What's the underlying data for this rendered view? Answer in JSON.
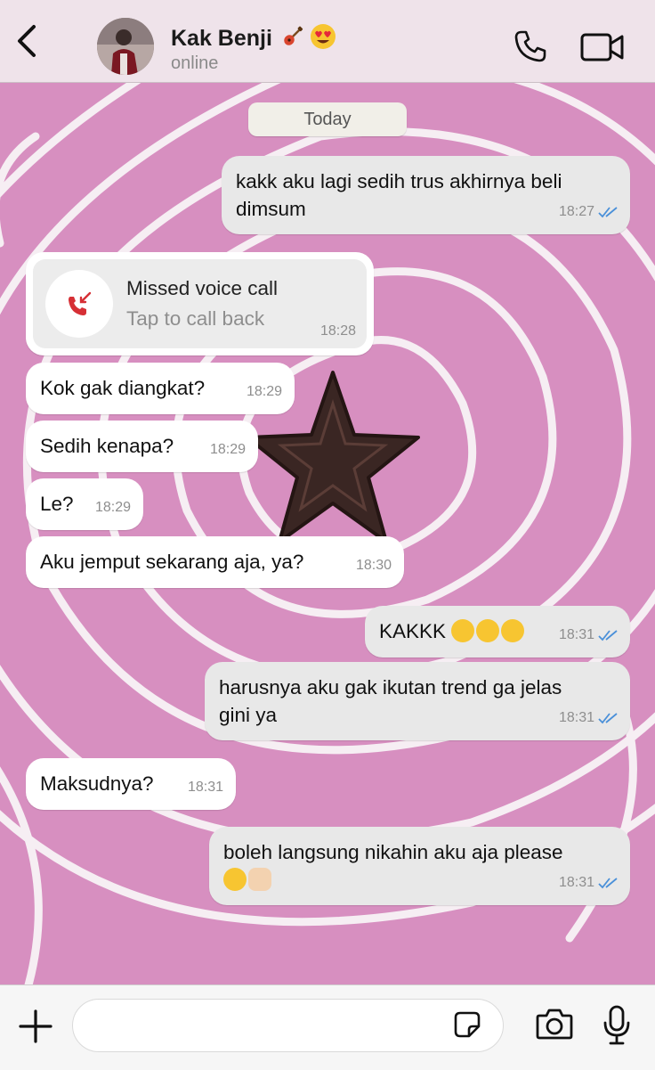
{
  "header": {
    "contact_name": "Kak Benji",
    "name_emojis": [
      "guitar-emoji",
      "heart-eyes-emoji"
    ],
    "status": "online"
  },
  "chat": {
    "date_divider": "Today",
    "messages": [
      {
        "dir": "out",
        "text": "kakk aku lagi sedih trus akhirnya beli dimsum",
        "time": "18:27",
        "read": true
      },
      {
        "type": "missed_call",
        "dir": "in",
        "title": "Missed voice call",
        "subtitle": "Tap to call back",
        "time": "18:28",
        "icon": "missed-call-icon"
      },
      {
        "dir": "in",
        "text": "Kok gak diangkat?",
        "time": "18:29"
      },
      {
        "dir": "in",
        "text": "Sedih kenapa?",
        "time": "18:29"
      },
      {
        "dir": "in",
        "text": "Le?",
        "time": "18:29"
      },
      {
        "dir": "in",
        "text": "Aku jemput sekarang aja, ya?",
        "time": "18:30"
      },
      {
        "dir": "out",
        "text": "KAKKK",
        "emojis": [
          "loudly-crying-emoji",
          "loudly-crying-emoji",
          "loudly-crying-emoji"
        ],
        "time": "18:31",
        "read": true
      },
      {
        "dir": "out",
        "text": "harusnya aku gak ikutan trend ga jelas gini ya",
        "time": "18:31",
        "read": true
      },
      {
        "dir": "in",
        "text": "Maksudnya?",
        "time": "18:31"
      },
      {
        "dir": "out",
        "text": "boleh langsung nikahin aku aja please",
        "emojis": [
          "pensive-emoji",
          "raised-hand-emoji"
        ],
        "time": "18:31",
        "read": true
      }
    ]
  },
  "composer": {
    "placeholder": "",
    "icons": [
      "plus-icon",
      "sticker-icon",
      "camera-icon",
      "microphone-icon"
    ]
  },
  "colors": {
    "wallpaper": "#d78fc0",
    "outgoing_bubble": "#e8e8e8",
    "incoming_bubble": "#ffffff",
    "read_ticks": "#4a90d9",
    "missed_call_red": "#d62f35"
  }
}
